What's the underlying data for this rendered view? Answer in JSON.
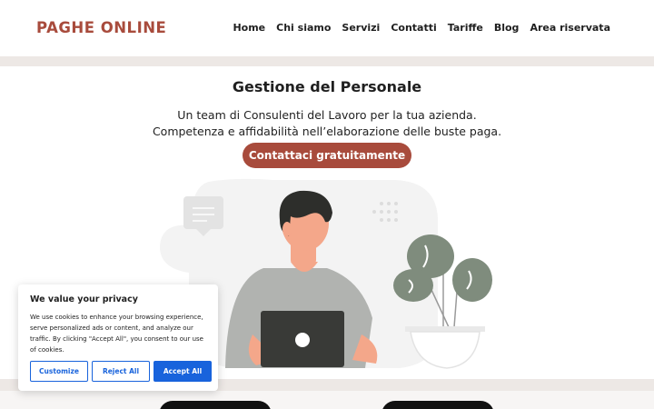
{
  "header": {
    "logo": "PAGHE ONLINE",
    "nav": [
      "Home",
      "Chi siamo",
      "Servizi",
      "Contatti",
      "Tariffe",
      "Blog",
      "Area riservata"
    ]
  },
  "hero": {
    "title": "Gestione del Personale",
    "line1": "Un team di Consulenti del Lavoro per la tua azienda.",
    "line2": "Competenza e affidabilità nell’elaborazione delle buste paga.",
    "cta": "Contattaci gratuitamente"
  },
  "cookie": {
    "title": "We value your privacy",
    "text": "We use cookies to enhance your browsing experience, serve personalized ads or content, and analyze our traffic. By clicking \"Accept All\", you consent to our use of cookies.",
    "customize": "Customize",
    "reject": "Reject All",
    "accept": "Accept All"
  },
  "colors": {
    "brand": "#a84b3c",
    "cookie_accent": "#1863dc",
    "band": "#ede8e5"
  }
}
